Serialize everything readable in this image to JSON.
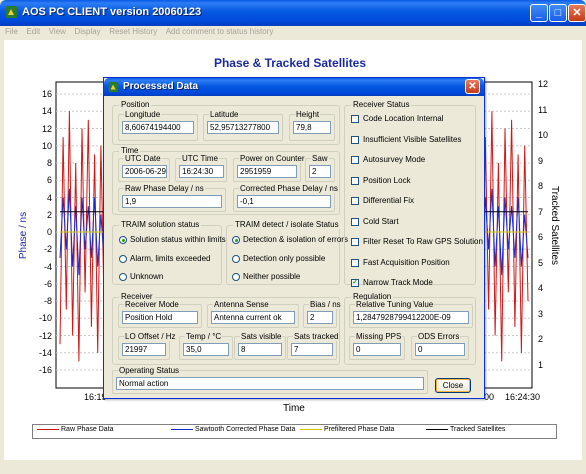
{
  "window": {
    "title": "AOS PC CLIENT version 20060123",
    "menu": [
      "File",
      "Edit",
      "View",
      "Display",
      "Reset History",
      "Add comment to status history"
    ]
  },
  "chart": {
    "title": "Phase & Tracked Satellites",
    "left_axis_label": "Phase / ns",
    "right_axis_label": "Tracked Satellites",
    "x_axis_label": "Time",
    "left_ticks": [
      "16",
      "14",
      "12",
      "10",
      "8",
      "6",
      "4",
      "2",
      "0",
      "-2",
      "-4",
      "-6",
      "-8",
      "-10",
      "-12",
      "-14",
      "-16"
    ],
    "right_ticks": [
      "12",
      "11",
      "10",
      "9",
      "8",
      "7",
      "6",
      "5",
      "4",
      "3",
      "2",
      "1"
    ],
    "x_tick_left": "16:19",
    "x_tick_right_a": "00",
    "x_tick_right_b": "16:24:30",
    "legend": [
      {
        "label": "Raw Phase Data",
        "color": "#d01818"
      },
      {
        "label": "Sawtooth Corrected Phase Data",
        "color": "#1e2bc8"
      },
      {
        "label": "Prefiltered Phase Data",
        "color": "#d6c600"
      },
      {
        "label": "Tracked Satellites",
        "color": "#000000"
      }
    ]
  },
  "chart_data": {
    "type": "line",
    "title": "Phase & Tracked Satellites",
    "xlabel": "Time",
    "ylabel": "Phase / ns",
    "y2label": "Tracked Satellites",
    "ylim": [
      -16,
      16
    ],
    "y2lim": [
      0,
      12
    ],
    "series": [
      {
        "name": "Raw Phase Data",
        "axis": "left",
        "values": [
          -13,
          11,
          -9,
          14,
          -12,
          8,
          -15,
          12,
          -7,
          13,
          -11,
          9,
          -14,
          10,
          -8
        ]
      },
      {
        "name": "Sawtooth Corrected Phase Data",
        "axis": "left",
        "values": [
          -3,
          4,
          -2,
          5,
          -4,
          3,
          -5,
          4,
          -2,
          3,
          -3,
          4,
          -4,
          2,
          -3
        ]
      },
      {
        "name": "Prefiltered Phase Data",
        "axis": "left",
        "values": [
          0,
          0,
          0,
          0,
          0,
          0,
          0,
          0,
          0,
          0,
          0,
          0,
          0,
          0,
          0
        ]
      },
      {
        "name": "Tracked Satellites",
        "axis": "right",
        "values": [
          7,
          7,
          7,
          7,
          7,
          7,
          7,
          7,
          7,
          7,
          7,
          7,
          7,
          7,
          7
        ]
      }
    ]
  },
  "dialog": {
    "title": "Processed Data",
    "position": {
      "caption": "Position",
      "longitude_label": "Longitude",
      "longitude": "8,60674194400",
      "latitude_label": "Latitude",
      "latitude": "52,95713277800",
      "height_label": "Height",
      "height": "79,8"
    },
    "time": {
      "caption": "Time",
      "utc_date_label": "UTC Date",
      "utc_date": "2006-06-29",
      "utc_time_label": "UTC Time",
      "utc_time": "16:24:30",
      "power_counter_label": "Power on Counter",
      "power_counter": "2951959",
      "saw_label": "Saw",
      "saw": "2",
      "raw_delay_label": "Raw Phase Delay / ns",
      "raw_delay": "1,9",
      "corr_delay_label": "Corrected Phase Delay / ns",
      "corr_delay": "-0,1"
    },
    "traim_solution": {
      "caption": "TRAIM solution status",
      "options": [
        "Solution status within limits",
        "Alarm, limits exceeded",
        "Unknown"
      ],
      "selected": 0
    },
    "traim_detect": {
      "caption": "TRAIM detect / isolate Status",
      "options": [
        "Detection & isolation of errors",
        "Detection only possible",
        "Neither possible"
      ],
      "selected": 0
    },
    "receiver_status": {
      "caption": "Receiver Status",
      "items": [
        {
          "label": "Code Location Internal",
          "checked": false
        },
        {
          "label": "Insufficient Visible Satellites",
          "checked": false
        },
        {
          "label": "Autosurvey Mode",
          "checked": false
        },
        {
          "label": "Position Lock",
          "checked": false
        },
        {
          "label": "Differential Fix",
          "checked": false
        },
        {
          "label": "Cold Start",
          "checked": false
        },
        {
          "label": "Filter Reset To Raw GPS Solution",
          "checked": false
        },
        {
          "label": "Fast Acquisition Position",
          "checked": false
        },
        {
          "label": "Narrow Track Mode",
          "checked": true
        }
      ]
    },
    "receiver": {
      "caption": "Receiver",
      "mode_label": "Receiver Mode",
      "mode": "Position Hold",
      "antenna_label": "Antenna Sense",
      "antenna": "Antenna current ok",
      "bias_label": "Bias / ns",
      "bias": "2",
      "lo_label": "LO Offset / Hz",
      "lo": "21997",
      "temp_label": "Temp / °C",
      "temp": "35,0",
      "sats_vis_label": "Sats visible",
      "sats_vis": "8",
      "sats_trk_label": "Sats tracked",
      "sats_trk": "7"
    },
    "regulation": {
      "caption": "Regulation",
      "tuning_label": "Relative Tuning Value",
      "tuning": "1,2847928799412200E-09",
      "missing_pps_label": "Missing PPS",
      "missing_pps": "0",
      "odds_label": "ODS Errors",
      "odds": "0"
    },
    "operating": {
      "caption": "Operating Status",
      "value": "Normal action"
    },
    "close_label": "Close"
  }
}
